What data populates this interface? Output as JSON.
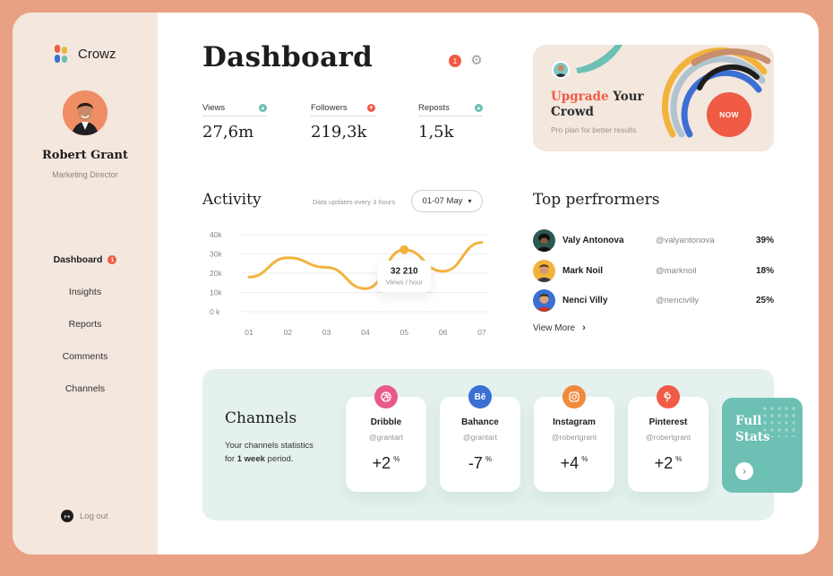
{
  "brand": {
    "name": "Crowz"
  },
  "user": {
    "name": "Robert Grant",
    "role": "Marketing Director"
  },
  "sidebar": {
    "items": [
      {
        "label": "Dashboard",
        "badge": "1",
        "active": true
      },
      {
        "label": "Insights"
      },
      {
        "label": "Reports"
      },
      {
        "label": "Comments"
      },
      {
        "label": "Channels"
      }
    ],
    "logout_label": "Log out"
  },
  "header": {
    "title": "Dashboard",
    "notification_count": "1"
  },
  "stats": [
    {
      "label": "Views",
      "value": "27,6m",
      "trend": "up"
    },
    {
      "label": "Followers",
      "value": "219,3k",
      "trend": "down"
    },
    {
      "label": "Reposts",
      "value": "1,5k",
      "trend": "up"
    }
  ],
  "upgrade": {
    "title_highlight": "Upgrade",
    "title_rest": "Your",
    "title_line2": "Crowd",
    "subtitle": "Pro plan for better results",
    "cta_label": "NOW"
  },
  "activity": {
    "title": "Activity",
    "note": "Data updates every 3 hours",
    "range": "01-07 May",
    "tooltip_value": "32 210",
    "tooltip_label": "Views / hour"
  },
  "chart_data": {
    "type": "line",
    "x": [
      "01",
      "02",
      "03",
      "04",
      "05",
      "06",
      "07"
    ],
    "series": [
      {
        "values": [
          18000,
          28000,
          23000,
          12000,
          32210,
          21000,
          36000
        ]
      }
    ],
    "ylim": [
      0,
      40000
    ],
    "yticks": [
      "0 k",
      "10k",
      "20k",
      "30k",
      "40k"
    ],
    "highlight": {
      "x": "05",
      "value": 32210
    },
    "color": "#f2b33d",
    "grid": true
  },
  "performers": {
    "title": "Top perfrormers",
    "rows": [
      {
        "name": "Valy Antonova",
        "handle": "@valyantonova",
        "pct": "39%"
      },
      {
        "name": "Mark Noil",
        "handle": "@marknoil",
        "pct": "18%"
      },
      {
        "name": "Nenci Villy",
        "handle": "@nencivilly",
        "pct": "25%"
      }
    ],
    "view_more": "View More"
  },
  "channels": {
    "title": "Channels",
    "desc_pre": "Your channels statistics for ",
    "desc_bold": "1 week",
    "desc_post": " period.",
    "cards": [
      {
        "name": "Dribble",
        "handle": "@grantart",
        "value": "+2",
        "unit": "%",
        "color": "#e85a8c",
        "icon": "dribbble-icon"
      },
      {
        "name": "Bahance",
        "handle": "@grantart",
        "value": "-7",
        "unit": "%",
        "color": "#3b6fd4",
        "icon": "behance-icon",
        "glyph": "Bē"
      },
      {
        "name": "Instagram",
        "handle": "@robertgrant",
        "value": "+4",
        "unit": "%",
        "color": "#f08a3c",
        "icon": "instagram-icon"
      },
      {
        "name": "Pinterest",
        "handle": "@robertgrant",
        "value": "+2",
        "unit": "%",
        "color": "#ef5b45",
        "icon": "pinterest-icon"
      }
    ],
    "full_stats_label": "Full Stats"
  }
}
